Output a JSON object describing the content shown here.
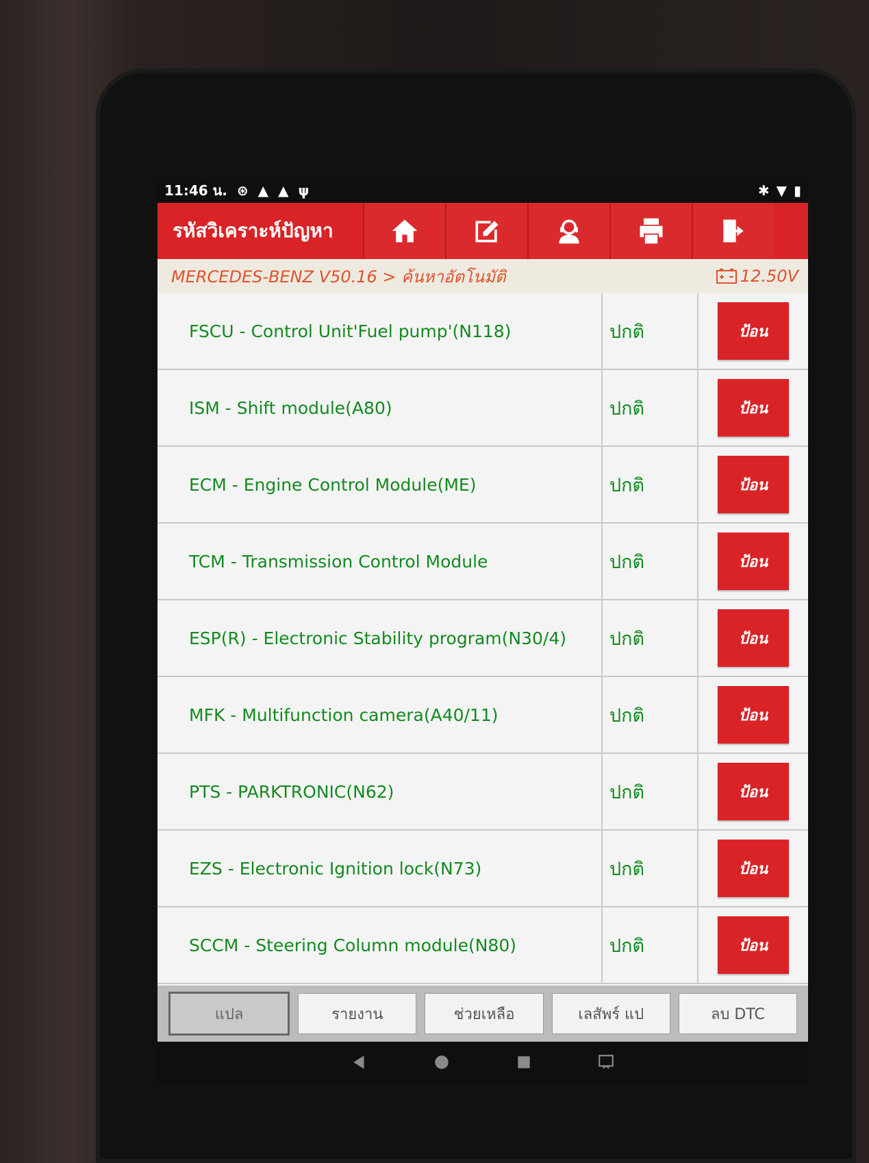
{
  "status_bar": {
    "time": "11:46 น."
  },
  "header": {
    "title": "รหัสวิเคราะห์ปัญหา",
    "buttons": [
      "home-icon",
      "edit-icon",
      "support-icon",
      "print-icon",
      "exit-icon"
    ]
  },
  "breadcrumb": {
    "path": "MERCEDES-BENZ V50.16 > ค้นหาอัตโนมัติ",
    "voltage": "12.50V"
  },
  "modules": [
    {
      "name": "FSCU - Control Unit'Fuel pump'(N118)",
      "status": "ปกติ",
      "action": "ป้อน"
    },
    {
      "name": "ISM - Shift module(A80)",
      "status": "ปกติ",
      "action": "ป้อน"
    },
    {
      "name": "ECM - Engine Control Module(ME)",
      "status": "ปกติ",
      "action": "ป้อน"
    },
    {
      "name": "TCM - Transmission Control Module",
      "status": "ปกติ",
      "action": "ป้อน"
    },
    {
      "name": "ESP(R) - Electronic Stability program(N30/4)",
      "status": "ปกติ",
      "action": "ป้อน"
    },
    {
      "name": "MFK - Multifunction camera(A40/11)",
      "status": "ปกติ",
      "action": "ป้อน"
    },
    {
      "name": "PTS - PARKTRONIC(N62)",
      "status": "ปกติ",
      "action": "ป้อน"
    },
    {
      "name": "EZS - Electronic Ignition lock(N73)",
      "status": "ปกติ",
      "action": "ป้อน"
    },
    {
      "name": "SCCM - Steering Column module(N80)",
      "status": "ปกติ",
      "action": "ป้อน"
    }
  ],
  "toolbar": {
    "buttons": [
      "แปล",
      "รายงาน",
      "ช่วยเหลือ",
      "เลสัพร์ แป",
      "ลบ DTC"
    ],
    "active_index": 0
  },
  "colors": {
    "accent": "#d92327",
    "status_text": "#138a20",
    "breadcrumb_text": "#e0522d"
  }
}
